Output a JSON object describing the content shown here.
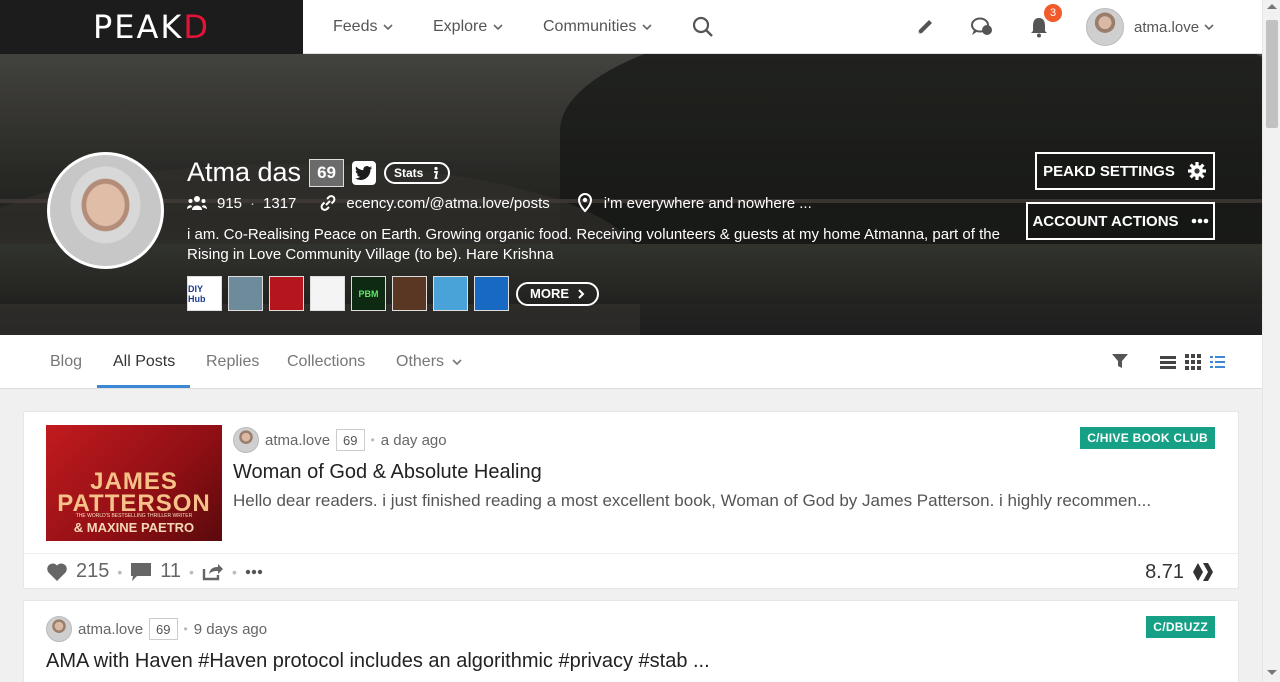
{
  "brand": {
    "logo_main": "PEAK",
    "logo_accent": "D"
  },
  "nav": {
    "feeds": "Feeds",
    "explore": "Explore",
    "communities": "Communities"
  },
  "header": {
    "notif_count": "3",
    "username": "atma.love"
  },
  "profile": {
    "name": "Atma das",
    "reputation": "69",
    "stats_label": "Stats",
    "followers": "915",
    "following": "1317",
    "website": "ecency.com/@atma.love/posts",
    "location": "i'm everywhere and nowhere ...",
    "bio": "i am. Co-Realising Peace on Earth. Growing organic food. Receiving volunteers & guests at my home Atmanna, part of the Rising in Love Community Village (to be). Hare Krishna",
    "more_label": "MORE",
    "settings_label": "PEAKD SETTINGS",
    "actions_label": "ACCOUNT ACTIONS",
    "badges": [
      {
        "text": "DIY Hub",
        "bg": "#ffffff",
        "fg": "#1a3a8f"
      },
      {
        "text": "",
        "bg": "#6d8b9a",
        "fg": "#ffffff"
      },
      {
        "text": "",
        "bg": "#b5161d",
        "fg": "#ffffff"
      },
      {
        "text": "",
        "bg": "#f4f4f4",
        "fg": "#333333"
      },
      {
        "text": "PBM",
        "bg": "#0f2a12",
        "fg": "#5fe36a"
      },
      {
        "text": "",
        "bg": "#5a3722",
        "fg": "#f0c090"
      },
      {
        "text": "",
        "bg": "#4aa3d8",
        "fg": "#ffffff"
      },
      {
        "text": "",
        "bg": "#1769c2",
        "fg": "#ffffff"
      }
    ]
  },
  "tabs": {
    "blog": "Blog",
    "all_posts": "All Posts",
    "replies": "Replies",
    "collections": "Collections",
    "others": "Others"
  },
  "posts": [
    {
      "author": "atma.love",
      "reputation": "69",
      "time": "a day ago",
      "community": "C/HIVE BOOK CLUB",
      "title": "Woman of God & Absolute Healing",
      "excerpt": "Hello dear readers. i just finished reading a most excellent book, Woman of God by James Patterson. i highly recommen...",
      "thumb_title": "JAMES PATTERSON",
      "thumb_tagline": "THE WORLD'S BESTSELLING THRILLER WRITER",
      "thumb_sub": "& MAXINE PAETRO",
      "votes": "215",
      "comments": "11",
      "payout": "8.71"
    },
    {
      "author": "atma.love",
      "reputation": "69",
      "time": "9 days ago",
      "community": "C/DBUZZ",
      "title": "AMA with Haven #Haven protocol includes an algorithmic #privacy #stab ..."
    }
  ],
  "colors": {
    "accent": "#3d88d5",
    "community": "#16a085",
    "notif": "#f15a2b",
    "logo_red": "#e31337"
  }
}
